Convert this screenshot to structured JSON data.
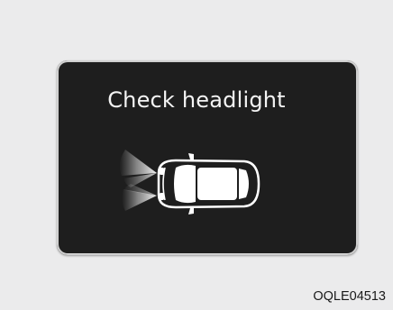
{
  "display": {
    "message": "Check headlight",
    "icon": "car-headlight-warning-icon"
  },
  "figure": {
    "code": "OQLE04513"
  },
  "colors": {
    "background": "#ebebec",
    "panel": "#1e1e1e",
    "text": "#f4f4f4"
  }
}
